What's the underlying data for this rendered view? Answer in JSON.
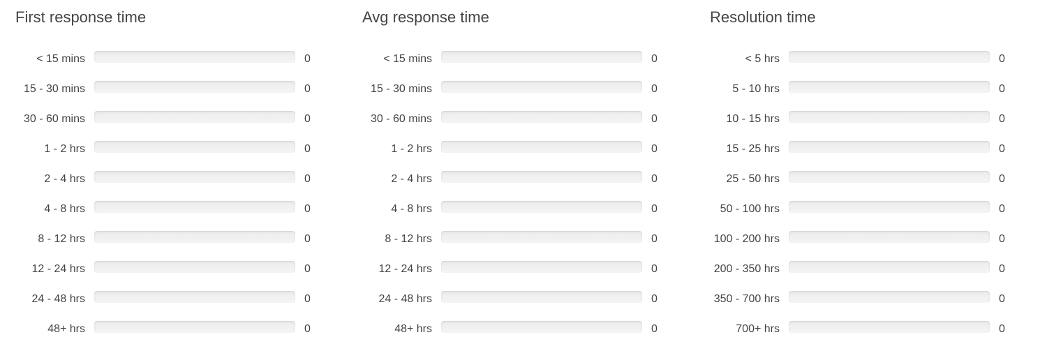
{
  "panels": [
    {
      "title": "First response time",
      "rows": [
        {
          "label": "< 15 mins",
          "value": "0",
          "fill": 0
        },
        {
          "label": "15 - 30 mins",
          "value": "0",
          "fill": 0
        },
        {
          "label": "30 - 60 mins",
          "value": "0",
          "fill": 0
        },
        {
          "label": "1 - 2 hrs",
          "value": "0",
          "fill": 0
        },
        {
          "label": "2 - 4 hrs",
          "value": "0",
          "fill": 0
        },
        {
          "label": "4 - 8 hrs",
          "value": "0",
          "fill": 0
        },
        {
          "label": "8 - 12 hrs",
          "value": "0",
          "fill": 0
        },
        {
          "label": "12 - 24 hrs",
          "value": "0",
          "fill": 0
        },
        {
          "label": "24 - 48 hrs",
          "value": "0",
          "fill": 0
        },
        {
          "label": "48+ hrs",
          "value": "0",
          "fill": 0
        }
      ]
    },
    {
      "title": "Avg response time",
      "rows": [
        {
          "label": "< 15 mins",
          "value": "0",
          "fill": 0
        },
        {
          "label": "15 - 30 mins",
          "value": "0",
          "fill": 0
        },
        {
          "label": "30 - 60 mins",
          "value": "0",
          "fill": 0
        },
        {
          "label": "1 - 2 hrs",
          "value": "0",
          "fill": 0
        },
        {
          "label": "2 - 4 hrs",
          "value": "0",
          "fill": 0
        },
        {
          "label": "4 - 8 hrs",
          "value": "0",
          "fill": 0
        },
        {
          "label": "8 - 12 hrs",
          "value": "0",
          "fill": 0
        },
        {
          "label": "12 - 24 hrs",
          "value": "0",
          "fill": 0
        },
        {
          "label": "24 - 48 hrs",
          "value": "0",
          "fill": 0
        },
        {
          "label": "48+ hrs",
          "value": "0",
          "fill": 0
        }
      ]
    },
    {
      "title": "Resolution time",
      "rows": [
        {
          "label": "< 5 hrs",
          "value": "0",
          "fill": 0
        },
        {
          "label": "5 - 10 hrs",
          "value": "0",
          "fill": 0
        },
        {
          "label": "10 - 15 hrs",
          "value": "0",
          "fill": 0
        },
        {
          "label": "15 - 25 hrs",
          "value": "0",
          "fill": 0
        },
        {
          "label": "25 - 50 hrs",
          "value": "0",
          "fill": 0
        },
        {
          "label": "50 - 100 hrs",
          "value": "0",
          "fill": 0
        },
        {
          "label": "100 - 200 hrs",
          "value": "0",
          "fill": 0
        },
        {
          "label": "200 - 350 hrs",
          "value": "0",
          "fill": 0
        },
        {
          "label": "350 - 700 hrs",
          "value": "0",
          "fill": 0
        },
        {
          "label": "700+ hrs",
          "value": "0",
          "fill": 0
        }
      ]
    }
  ],
  "colors": {
    "bar_fill": "#5bc0de",
    "track": "#efefef",
    "text": "#444444"
  }
}
